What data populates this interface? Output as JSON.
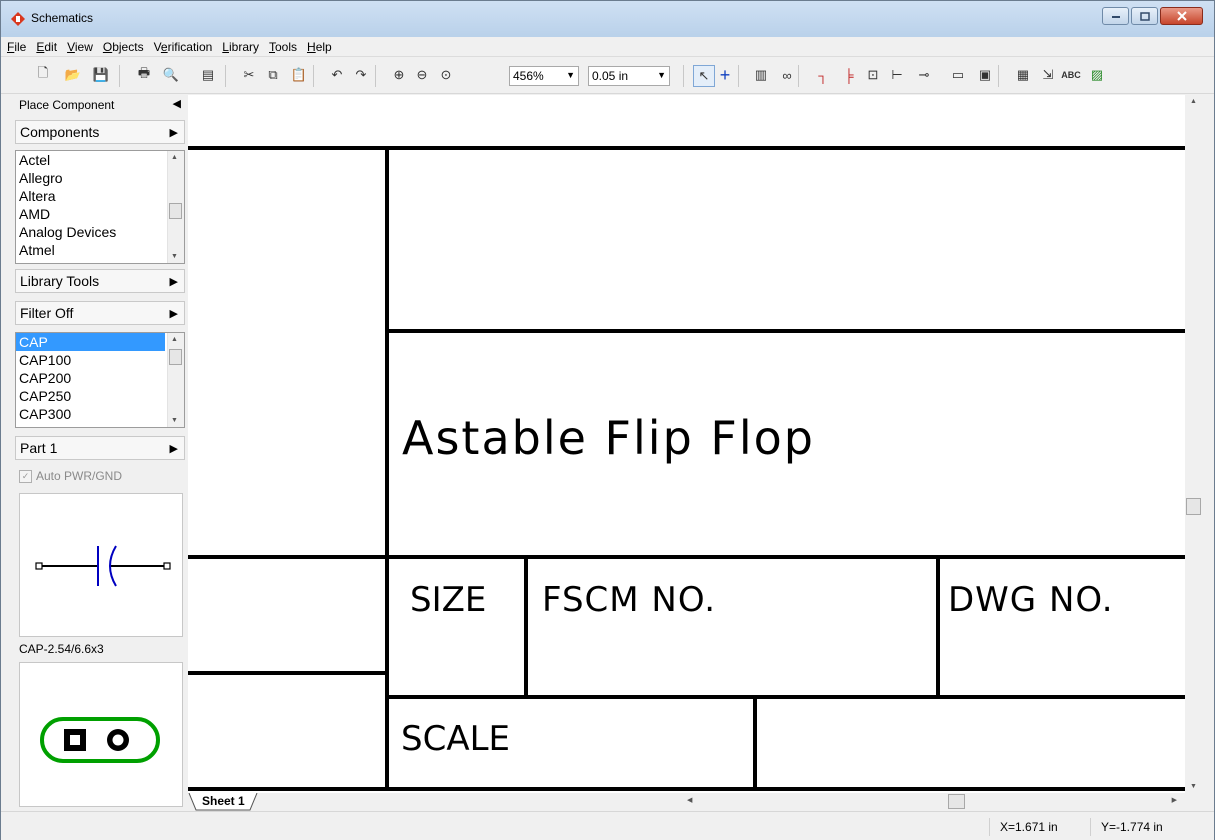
{
  "window": {
    "title": "Schematics"
  },
  "menu": [
    "File",
    "Edit",
    "View",
    "Objects",
    "Verification",
    "Library",
    "Tools",
    "Help"
  ],
  "menu_underline": [
    "F",
    "E",
    "V",
    "O",
    "e",
    "L",
    "T",
    "H"
  ],
  "toolbar": {
    "zoom": "456%",
    "grid": "0.05 in",
    "icons": [
      "new-file-icon",
      "open-folder-icon",
      "save-icon",
      "print-icon",
      "print-preview-icon",
      "page-setup-icon",
      "cut-icon",
      "copy-icon",
      "paste-icon",
      "undo-icon",
      "redo-icon",
      "zoom-in-icon",
      "zoom-out-icon",
      "zoom-fit-icon",
      "select-arrow-icon",
      "crosshair-icon",
      "component-icon",
      "find-binoculars-icon",
      "wire-icon",
      "bus-icon",
      "net-port-icon",
      "pin-icon",
      "connector-icon",
      "hierarchy-block-icon",
      "chip-icon",
      "table-icon",
      "export-icon",
      "text-abc-icon",
      "image-icon"
    ],
    "text_abc": "ABC"
  },
  "sidebar": {
    "place_component": "Place Component",
    "components": "Components",
    "manufacturers": [
      "Actel",
      "Allegro",
      "Altera",
      "AMD",
      "Analog Devices",
      "Atmel"
    ],
    "library_tools": "Library Tools",
    "filter": "Filter Off",
    "parts": [
      "CAP",
      "CAP100",
      "CAP200",
      "CAP250",
      "CAP300"
    ],
    "part_selector": "Part 1",
    "auto_pwr": "Auto PWR/GND",
    "footprint_name": "CAP-2.54/6.6x3"
  },
  "drawing": {
    "title": "Astable Flip Flop",
    "size_label": "SIZE",
    "fscm_label": "FSCM NO.",
    "dwg_label": "DWG NO.",
    "scale_label": "SCALE"
  },
  "sheet_tab": "Sheet 1",
  "status": {
    "x": "X=1.671 in",
    "y": "Y=-1.774 in"
  },
  "colors": {
    "selection": "#3399ff",
    "symbol": "#0000c0",
    "footprint": "#00a000"
  }
}
